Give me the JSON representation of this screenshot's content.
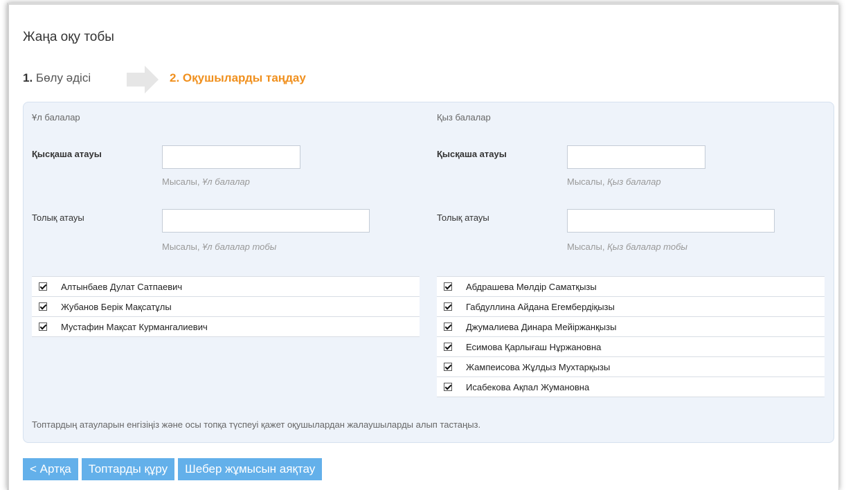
{
  "page": {
    "title": "Жаңа оқу тобы"
  },
  "steps": {
    "step1_number": "1.",
    "step1_label": "Бөлу әдісі",
    "step2_label": "2. Оқушыларды таңдау",
    "arrow_icon": "right-arrow-icon",
    "active_color": "#f0901e"
  },
  "boys": {
    "group_title": "Ұл балалар",
    "short_name_label": "Қысқаша атауы",
    "short_name_value": "",
    "short_name_hint_prefix": "Мысалы,",
    "short_name_hint_example": "Ұл балалар",
    "full_name_label": "Толық атауы",
    "full_name_value": "",
    "full_name_hint_prefix": "Мысалы,",
    "full_name_hint_example": "Ұл балалар тобы",
    "students": [
      {
        "name": "Алтынбаев Дулат Сатпаевич",
        "checked": true
      },
      {
        "name": "Жубанов Берік Мақсатұлы",
        "checked": true
      },
      {
        "name": "Мустафин Мақсат Курмангалиевич",
        "checked": true
      }
    ]
  },
  "girls": {
    "group_title": "Қыз балалар",
    "short_name_label": "Қысқаша атауы",
    "short_name_value": "",
    "short_name_hint_prefix": "Мысалы,",
    "short_name_hint_example": "Қыз балалар",
    "full_name_label": "Толық атауы",
    "full_name_value": "",
    "full_name_hint_prefix": "Мысалы,",
    "full_name_hint_example": "Қыз балалар тобы",
    "students": [
      {
        "name": "Абдрашева Мөлдір Саматқызы",
        "checked": true
      },
      {
        "name": "Габдуллина Айдана Егембердіқызы",
        "checked": true
      },
      {
        "name": "Джумалиева Динара Мейіржанқызы",
        "checked": true
      },
      {
        "name": "Есимова Қарлығаш Нұржановна",
        "checked": true
      },
      {
        "name": "Жампеисова Жұлдыз Мухтарқызы",
        "checked": true
      },
      {
        "name": "Исабекова Ақпал Жумановна",
        "checked": true
      }
    ]
  },
  "footer_note": "Топтардың атауларын енгізіңіз және осы топқа түспеуі қажет оқушылардан жалаушыларды алып тастаңыз.",
  "buttons": {
    "back_label": "< Артқа",
    "create_label": "Топтарды құру",
    "finish_label": "Шебер жұмысын аяқтау",
    "color": "#63b0ea"
  }
}
